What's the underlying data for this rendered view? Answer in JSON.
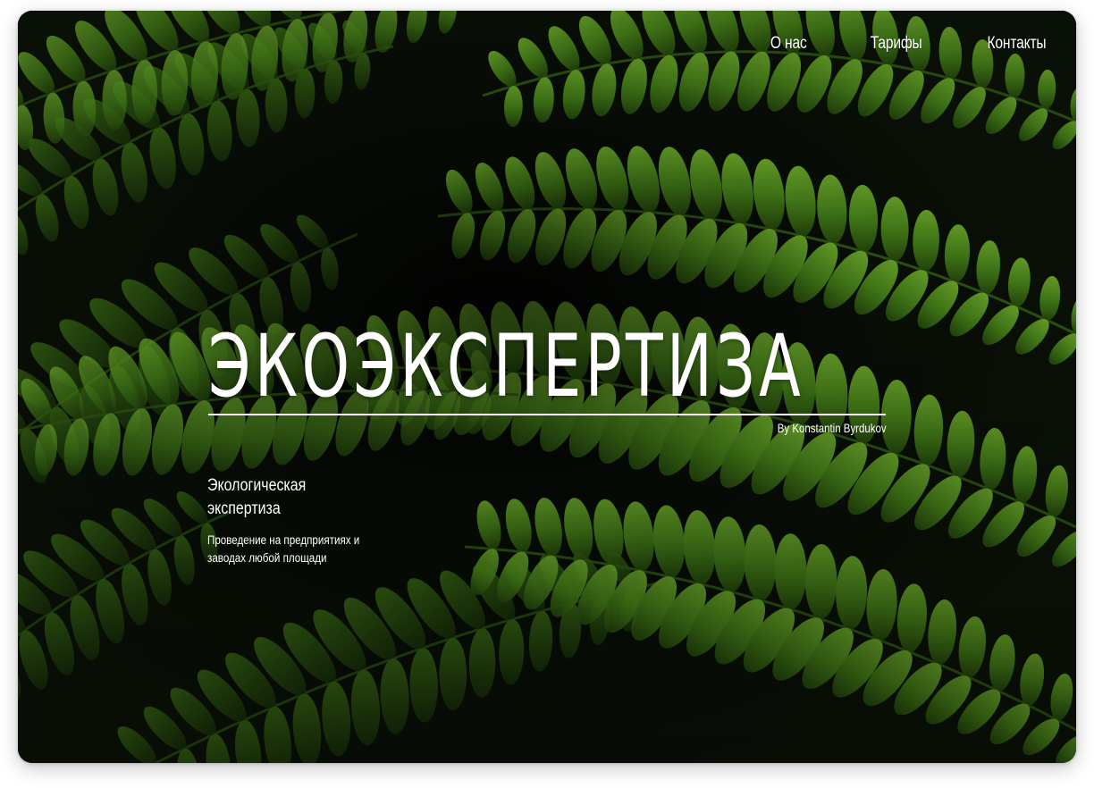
{
  "nav": {
    "items": [
      {
        "label": "О нас"
      },
      {
        "label": "Тарифы"
      },
      {
        "label": "Контакты"
      }
    ]
  },
  "hero": {
    "title": "ЭКОЭКСПЕРТИЗА",
    "byline": "By Konstantin Byrdukov",
    "subtitle": "Экологическая экспертиза",
    "description": "Проведение на предприятиях и заводах любой площади"
  },
  "background": {
    "subject": "fern-leaves-photo",
    "colors": {
      "dark": "#070a05",
      "leaf_light": "#5f9a24",
      "leaf_mid": "#3f7417",
      "leaf_dark": "#1d3a0b"
    }
  }
}
